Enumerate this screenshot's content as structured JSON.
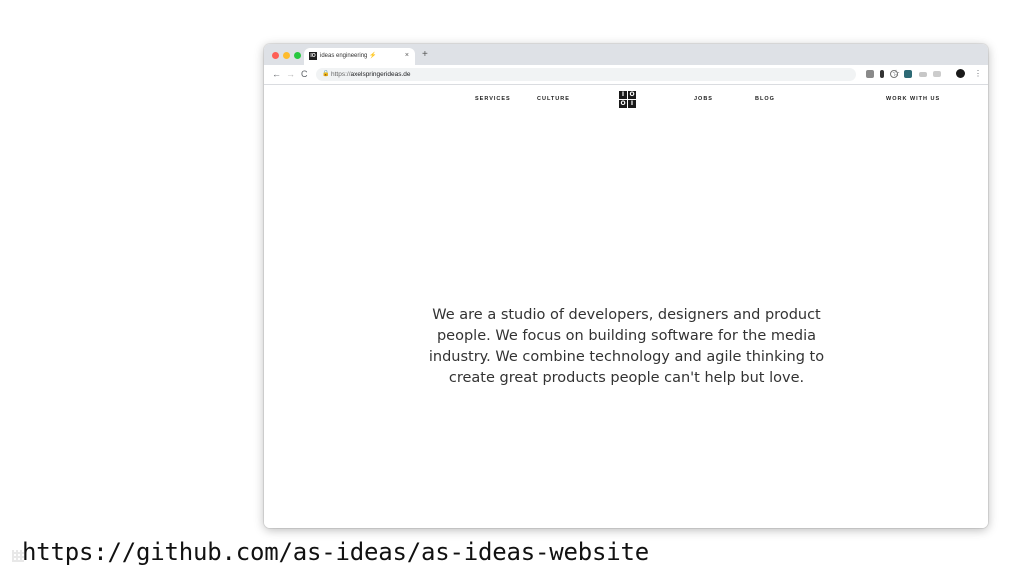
{
  "browser": {
    "tab": {
      "favicon_text": "IO",
      "title": "ideas engineering",
      "title_emoji": "⚡",
      "close_symbol": "×"
    },
    "new_tab_symbol": "+",
    "nav": {
      "back": "←",
      "forward": "→",
      "reload": "C"
    },
    "address": {
      "scheme": "https://",
      "host": "axelspringerideas.de"
    },
    "bookmark_icon": "☆",
    "menu_icon": "⋮"
  },
  "site": {
    "nav": {
      "services": "SERVICES",
      "culture": "CULTURE",
      "jobs": "JOBS",
      "blog": "BLOG",
      "work_with_us": "WORK WITH US"
    },
    "logo": [
      "I",
      "O",
      "O",
      "I"
    ],
    "hero_text": "We are a studio of developers, designers and product people. We focus on building software for the media industry. We combine technology and agile thinking to create great products people can't help but love.",
    "accent_color": "#4fb3d9"
  },
  "caption": {
    "url": "https://github.com/as-ideas/as-ideas-website"
  }
}
